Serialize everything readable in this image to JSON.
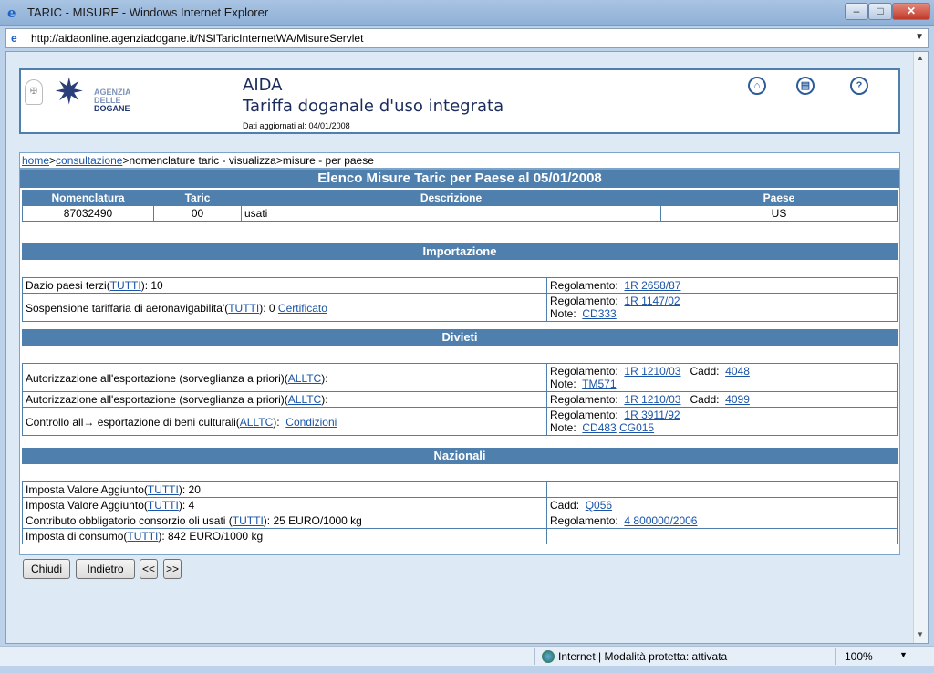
{
  "window": {
    "title": "TARIC - MISURE - Windows Internet Explorer",
    "min": "–",
    "max": "□",
    "close": "✕",
    "url": "http://aidaonline.agenziadogane.it/NSITaricInternetWA/MisureServlet",
    "status_zone": "Internet | Modalità protetta: attivata",
    "zoom": "100%"
  },
  "header": {
    "logo_line1": "AGENZIA",
    "logo_line2": "DELLE",
    "logo_line3": "DOGANE",
    "app_name": "AIDA",
    "subtitle": "Tariffa doganale d'uso integrata",
    "updated": "Dati aggiornati al: 04/01/2008"
  },
  "breadcrumb": {
    "home": "home",
    "sep1": ">",
    "consultazione": "consultazione",
    "rest": ">nomenclature taric - visualizza>misure - per paese"
  },
  "main_title": "Elenco Misure Taric per Paese al 05/01/2008",
  "columns": [
    "Nomenclatura",
    "Taric",
    "Descrizione",
    "Paese"
  ],
  "item": {
    "nomenclatura": "87032490",
    "taric": "00",
    "descrizione": "usati",
    "paese": "US"
  },
  "sections": {
    "importazione": "Importazione",
    "divieti": "Divieti",
    "nazionali": "Nazionali"
  },
  "imp": [
    {
      "label": "Dazio paesi terzi(",
      "link": "TUTTI",
      "after": "): 10",
      "r1_label": "Regolamento:",
      "r1_link": "1R 2658/87"
    },
    {
      "label": "Sospensione tariffaria di aeronavigabilita'(",
      "link": "TUTTI",
      "after": "): 0",
      "link2": "Certificato",
      "r1_label": "Regolamento:",
      "r1_link": "1R 1147/02",
      "r2_label": "Note:",
      "r2_link": "CD333"
    }
  ],
  "div": [
    {
      "label": "Autorizzazione all'esportazione (sorveglianza a priori)(",
      "link": "ALLTC",
      "after": "):",
      "r1_label": "Regolamento:",
      "r1_link": "1R 1210/03",
      "cadd_label": "Cadd:",
      "cadd_link": "4048",
      "r2_label": "Note:",
      "r2_link": "TM571"
    },
    {
      "label": "Autorizzazione all'esportazione (sorveglianza a priori)(",
      "link": "ALLTC",
      "after": "):",
      "r1_label": "Regolamento:",
      "r1_link": "1R 1210/03",
      "cadd_label": "Cadd:",
      "cadd_link": "4099"
    },
    {
      "label": "Controllo all→ esportazione di beni culturali(",
      "link": "ALLTC",
      "after": "):",
      "link2": "Condizioni",
      "r1_label": "Regolamento:",
      "r1_link": "1R 3911/92",
      "r2_label": "Note:",
      "r2_link": "CD483",
      "r2_link2": "CG015"
    }
  ],
  "naz": [
    {
      "label": "Imposta Valore Aggiunto(",
      "link": "TUTTI",
      "after": "):  20"
    },
    {
      "label": "Imposta Valore Aggiunto(",
      "link": "TUTTI",
      "after": "):  4",
      "r_label": "Cadd:",
      "r_link": "Q056"
    },
    {
      "label": "Contributo obbligatorio consorzio oli usati (",
      "link": "TUTTI",
      "after": "):  25 EURO/1000 kg",
      "r_label": "Regolamento:",
      "r_link": "4 800000/2006"
    },
    {
      "label": "Imposta di consumo(",
      "link": "TUTTI",
      "after": "):  842 EURO/1000 kg"
    }
  ],
  "buttons": {
    "chiudi": "Chiudi",
    "indietro": "Indietro",
    "prev": "<<",
    "next": ">>"
  }
}
